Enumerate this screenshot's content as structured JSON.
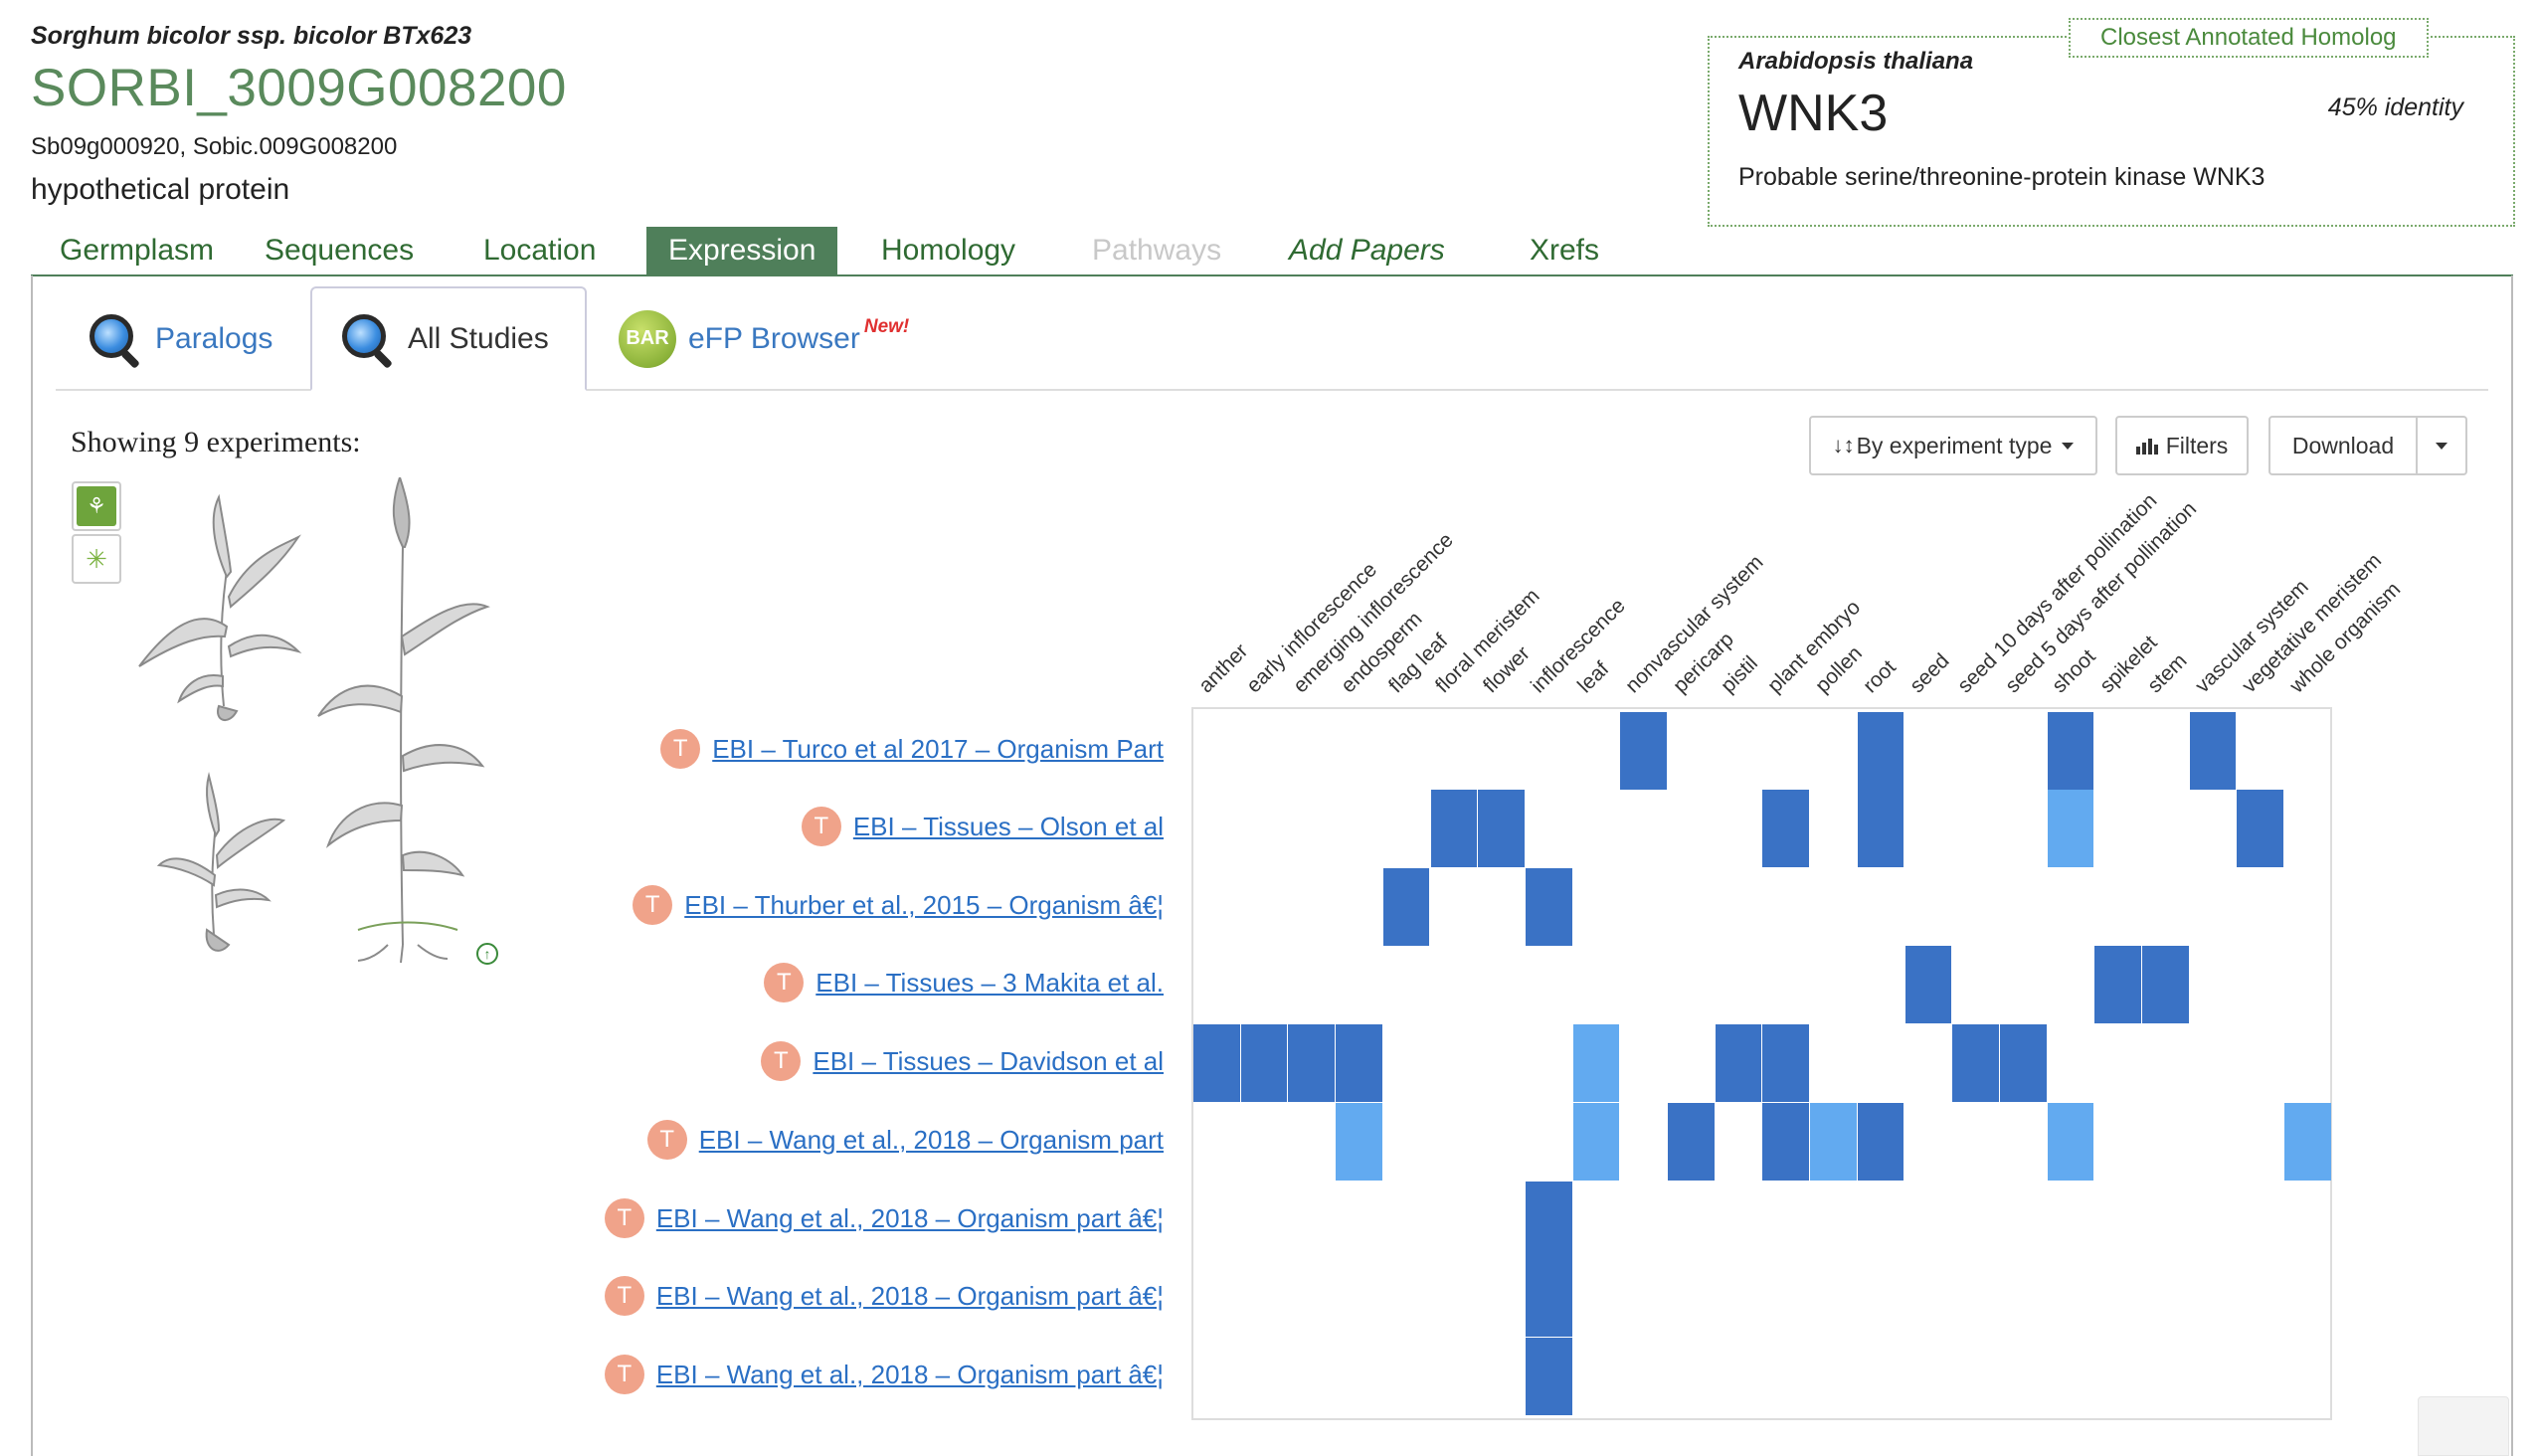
{
  "header": {
    "species": "Sorghum bicolor ssp. bicolor BTx623",
    "gene_id": "SORBI_3009G008200",
    "synonyms": "Sb09g000920, Sobic.009G008200",
    "description": "hypothetical protein"
  },
  "homolog": {
    "legend": "Closest Annotated Homolog",
    "species": "Arabidopsis thaliana",
    "gene": "WNK3",
    "identity": "45% identity",
    "description": "Probable serine/threonine-protein kinase WNK3"
  },
  "main_tabs": [
    {
      "label": "Germplasm",
      "state": "normal"
    },
    {
      "label": "Sequences",
      "state": "normal"
    },
    {
      "label": "Location",
      "state": "normal"
    },
    {
      "label": "Expression",
      "state": "active"
    },
    {
      "label": "Homology",
      "state": "normal"
    },
    {
      "label": "Pathways",
      "state": "disabled"
    },
    {
      "label": "Add Papers",
      "state": "italic"
    },
    {
      "label": "Xrefs",
      "state": "normal"
    }
  ],
  "sub_tabs": [
    {
      "label": "Paralogs",
      "icon": "magnifier-icon",
      "active": false
    },
    {
      "label": "All Studies",
      "icon": "magnifier-icon",
      "active": true
    },
    {
      "label": "eFP Browser",
      "icon": "bar-icon",
      "icon_text": "BAR",
      "badge": "New!",
      "active": false
    }
  ],
  "toolbar": {
    "showing": "Showing 9 experiments:",
    "sort_label": "By experiment type",
    "sort_icon": "sort-icon",
    "filters_label": "Filters",
    "filters_icon": "filter-grid-icon",
    "download_label": "Download"
  },
  "colors": {
    "high": "#3a72c5",
    "low": "#62aaf0",
    "link": "#2a6fc4",
    "accent_green": "#4f7f5a",
    "badge_salmon": "#f0a38a"
  },
  "heatmap": {
    "columns": [
      "anther",
      "early inflorescence",
      "emerging inflorescence",
      "endosperm",
      "flag leaf",
      "floral meristem",
      "flower",
      "inflorescence",
      "leaf",
      "nonvascular system",
      "pericarp",
      "pistil",
      "plant embryo",
      "pollen",
      "root",
      "seed",
      "seed 10 days after pollination",
      "seed 5 days after pollination",
      "shoot",
      "spikelet",
      "stem",
      "vascular system",
      "vegetative meristem",
      "whole organism"
    ],
    "rows": [
      {
        "label": "EBI – Turco et al 2017 – Organism Part",
        "badge": "T",
        "cells": [
          [
            9,
            "high"
          ],
          [
            14,
            "high"
          ],
          [
            18,
            "high"
          ],
          [
            21,
            "high"
          ]
        ]
      },
      {
        "label": "EBI – Tissues – Olson et al",
        "badge": "T",
        "cells": [
          [
            5,
            "high"
          ],
          [
            6,
            "high"
          ],
          [
            12,
            "high"
          ],
          [
            14,
            "high"
          ],
          [
            18,
            "low"
          ],
          [
            22,
            "high"
          ]
        ]
      },
      {
        "label": "EBI – Thurber et al., 2015 – Organism â€¦",
        "badge": "T",
        "cells": [
          [
            4,
            "high"
          ],
          [
            7,
            "high"
          ]
        ]
      },
      {
        "label": "EBI – Tissues – 3 Makita et al.",
        "badge": "T",
        "cells": [
          [
            15,
            "high"
          ],
          [
            19,
            "high"
          ],
          [
            20,
            "high"
          ]
        ]
      },
      {
        "label": "EBI – Tissues – Davidson et al",
        "badge": "T",
        "cells": [
          [
            0,
            "high"
          ],
          [
            1,
            "high"
          ],
          [
            2,
            "high"
          ],
          [
            3,
            "high"
          ],
          [
            8,
            "low"
          ],
          [
            11,
            "high"
          ],
          [
            12,
            "high"
          ],
          [
            16,
            "high"
          ],
          [
            17,
            "high"
          ]
        ]
      },
      {
        "label": "EBI – Wang et al., 2018 – Organism part",
        "badge": "T",
        "cells": [
          [
            3,
            "low"
          ],
          [
            8,
            "low"
          ],
          [
            10,
            "high"
          ],
          [
            12,
            "high"
          ],
          [
            13,
            "low"
          ],
          [
            14,
            "high"
          ],
          [
            18,
            "low"
          ],
          [
            23,
            "low"
          ]
        ]
      },
      {
        "label": "EBI – Wang et al., 2018 – Organism part â€¦",
        "badge": "T",
        "cells": [
          [
            7,
            "high"
          ]
        ]
      },
      {
        "label": "EBI – Wang et al., 2018 – Organism part â€¦",
        "badge": "T",
        "cells": [
          [
            7,
            "high"
          ]
        ]
      },
      {
        "label": "EBI – Wang et al., 2018 – Organism part â€¦",
        "badge": "T",
        "cells": [
          [
            7,
            "high"
          ]
        ]
      }
    ]
  }
}
